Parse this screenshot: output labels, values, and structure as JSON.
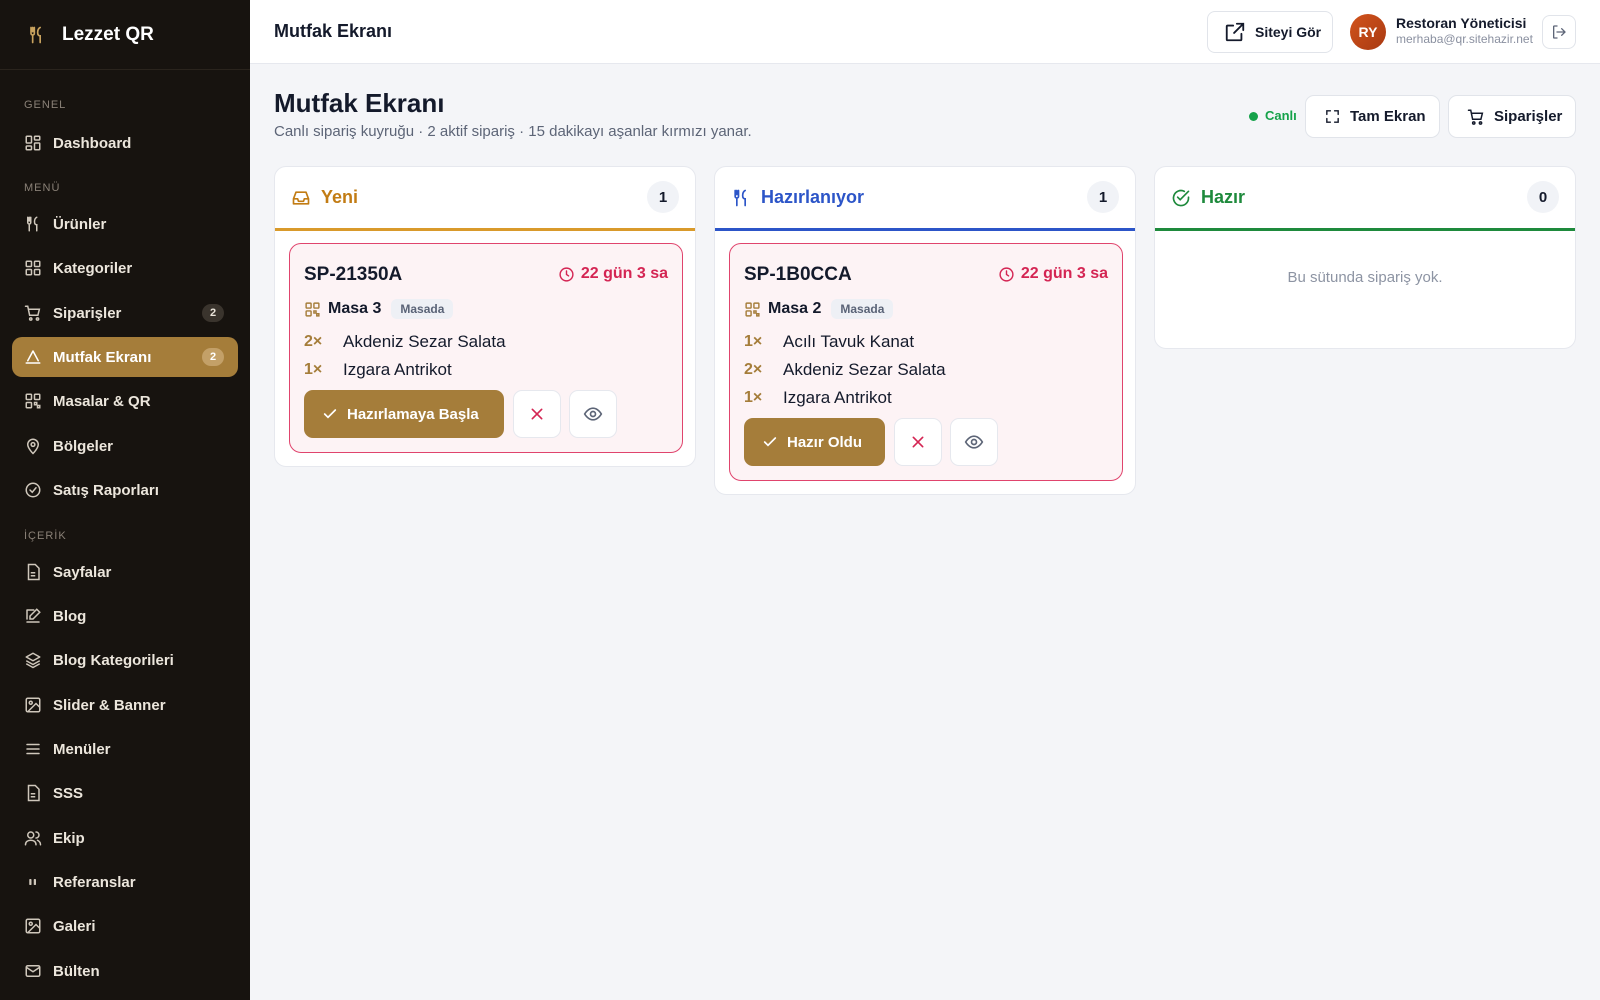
{
  "brand": {
    "name": "Lezzet QR"
  },
  "sidebar": {
    "sections": [
      "GENEL",
      "MENÜ",
      "İÇERİK"
    ],
    "items": [
      {
        "label": "Dashboard"
      },
      {
        "label": "Ürünler"
      },
      {
        "label": "Kategoriler"
      },
      {
        "label": "Siparişler",
        "badge": "2"
      },
      {
        "label": "Mutfak Ekranı",
        "badge": "2"
      },
      {
        "label": "Masalar & QR"
      },
      {
        "label": "Bölgeler"
      },
      {
        "label": "Satış Raporları"
      },
      {
        "label": "Sayfalar"
      },
      {
        "label": "Blog"
      },
      {
        "label": "Blog Kategorileri"
      },
      {
        "label": "Slider & Banner"
      },
      {
        "label": "Menüler"
      },
      {
        "label": "SSS"
      },
      {
        "label": "Ekip"
      },
      {
        "label": "Referanslar"
      },
      {
        "label": "Galeri"
      },
      {
        "label": "Bülten"
      }
    ]
  },
  "topbar": {
    "title": "Mutfak Ekranı",
    "site_button": "Siteyi Gör",
    "user": {
      "initials": "RY",
      "name": "Restoran Yöneticisi",
      "email": "merhaba@qr.sitehazir.net"
    }
  },
  "page": {
    "title": "Mutfak Ekranı",
    "subtitle": "Canlı sipariş kuyruğu · 2 aktif sipariş · 15 dakikayı aşanlar kırmızı yanar.",
    "live_label": "Canlı",
    "fullscreen_button": "Tam Ekran",
    "orders_button": "Siparişler"
  },
  "columns": [
    {
      "title": "Yeni",
      "count": "1",
      "color": "#c27c14",
      "order": {
        "id": "SP-21350A",
        "time": "22 gün 3 sa",
        "table": "Masa 3",
        "tag": "Masada",
        "items": [
          {
            "qty": "2×",
            "name": "Akdeniz Sezar Salata"
          },
          {
            "qty": "1×",
            "name": "Izgara Antrikot"
          }
        ],
        "action": "Hazırlamaya Başla"
      }
    },
    {
      "title": "Hazırlanıyor",
      "count": "1",
      "color": "#2c55c8",
      "order": {
        "id": "SP-1B0CCA",
        "time": "22 gün 3 sa",
        "table": "Masa 2",
        "tag": "Masada",
        "items": [
          {
            "qty": "1×",
            "name": "Acılı Tavuk Kanat"
          },
          {
            "qty": "2×",
            "name": "Akdeniz Sezar Salata"
          },
          {
            "qty": "1×",
            "name": "Izgara Antrikot"
          }
        ],
        "action": "Hazır Oldu"
      }
    },
    {
      "title": "Hazır",
      "count": "0",
      "color": "#1e8a3c",
      "empty": "Bu sütunda sipariş yok."
    }
  ],
  "colors": {
    "accent": "#a57d3a",
    "alert": "#d42553",
    "live": "#15a24a"
  }
}
